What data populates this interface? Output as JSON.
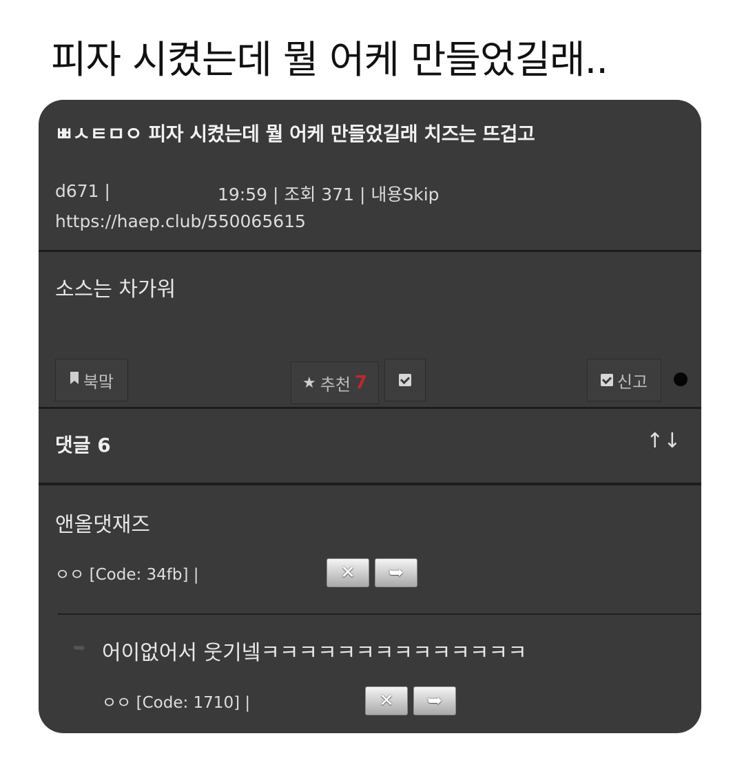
{
  "headline": "피자 시켰는데 뭘 어케 만들었길래..",
  "post": {
    "title": "ㅃㅅㅌㅁㅇ 피자 시켰는데 뭘 어케 만들었길래  치즈는 뜨겁고",
    "author": "d671 |",
    "info": "19:59 | 조회 371 | 내용Skip",
    "url": "https://haep.club/550065615",
    "body": "소스는 차가워"
  },
  "actions": {
    "bookmark": "북맠",
    "recommend": "추천",
    "recommend_count": "7",
    "report": "신고"
  },
  "comments_header": {
    "label": "댓글 6",
    "sort_icon": "↑↓"
  },
  "comments": [
    {
      "text": "앤올댓재즈",
      "meta": "ㅇㅇ [Code: 34fb] |"
    },
    {
      "text": "어이없어서 웃기넼ㅋㅋㅋㅋㅋㅋㅋㅋㅋㅋㅋㅋㅋㅋ",
      "meta": "ㅇㅇ [Code: 1710] |"
    }
  ],
  "icons": {
    "bookmark": "bookmark-icon",
    "star": "star-icon",
    "check": "checkbox-icon",
    "delete": "x-icon",
    "reply": "reply-arrow-icon"
  },
  "colors": {
    "card_bg": "#3a3a3a",
    "recommend_count": "#c0272d"
  }
}
